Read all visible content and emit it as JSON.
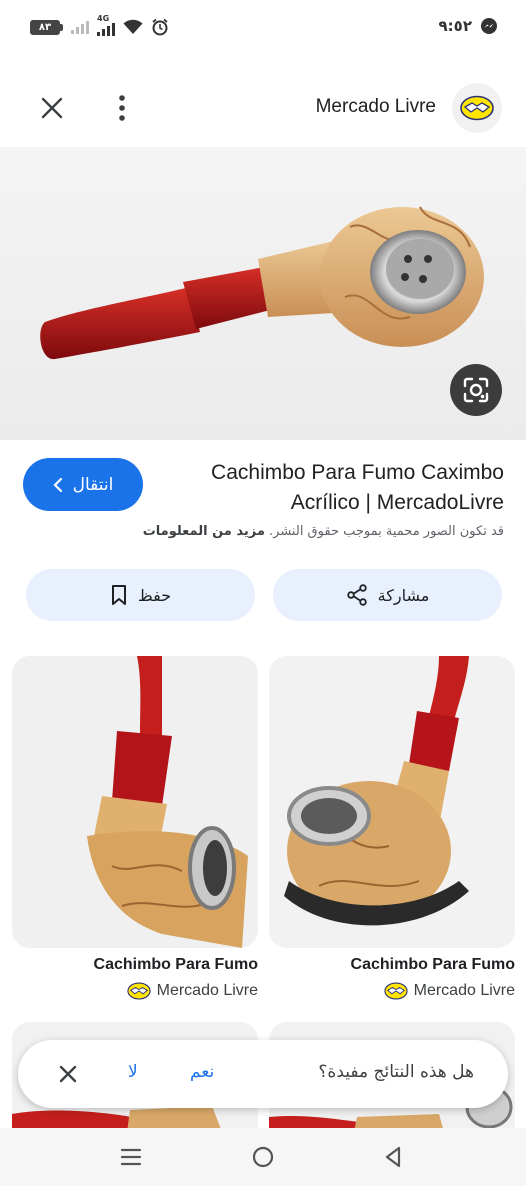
{
  "status_bar": {
    "time": "٩:٥٢",
    "battery": "٨٣",
    "network": "4G"
  },
  "header": {
    "site_name": "Mercado Livre"
  },
  "result": {
    "title": "Cachimbo Para Fumo Caximbo Acrílico | MercadoLivre",
    "visit_label": "انتقال",
    "copyright_text": "قد تكون الصور محمية بموجب حقوق النشر.",
    "learn_more": "مزيد من المعلومات"
  },
  "actions": {
    "share_label": "مشاركة",
    "save_label": "حفظ"
  },
  "related": [
    {
      "title": "Cachimbo Para Fumo",
      "source": "Mercado Livre"
    },
    {
      "title": "Cachimbo Para Fumo",
      "source": "Mercado Livre"
    }
  ],
  "feedback": {
    "question": "هل هذه النتائج مفيدة؟",
    "yes": "نعم",
    "no": "لا"
  },
  "colors": {
    "accent": "#1a73e8",
    "pill_bg": "#e8f0fe"
  },
  "icons": [
    "close-icon",
    "more-vert-icon",
    "mercadolivre-logo",
    "lens-icon",
    "share-icon",
    "bookmark-icon",
    "chevron-left-icon",
    "menu-icon",
    "home-icon",
    "back-icon"
  ]
}
